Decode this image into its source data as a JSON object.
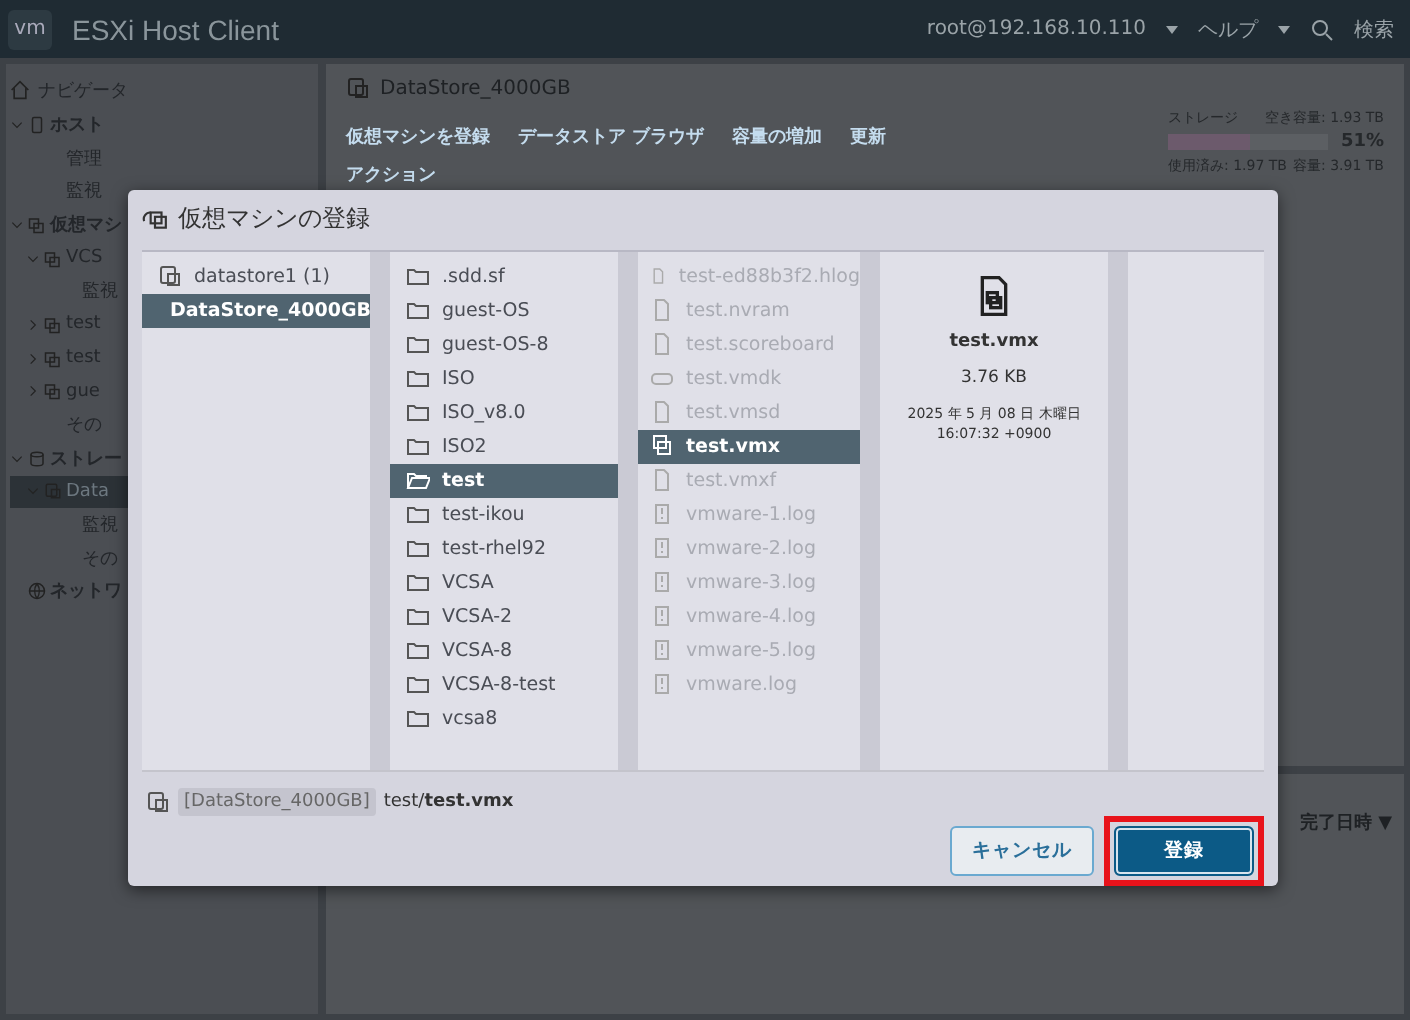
{
  "header": {
    "logo": "vm",
    "title": "ESXi Host Client",
    "user": "root@192.168.10.110",
    "help": "ヘルプ",
    "search": "検索"
  },
  "navigator": {
    "title": "ナビゲータ",
    "items": [
      {
        "label": "ホスト",
        "kind": "host",
        "expanded": true,
        "children": [
          {
            "label": "管理",
            "kind": "leaf"
          },
          {
            "label": "監視",
            "kind": "leaf"
          }
        ]
      },
      {
        "label": "仮想マシ",
        "kind": "vms",
        "expanded": true,
        "children": [
          {
            "label": "VCS",
            "kind": "vm",
            "expanded": true,
            "children": [
              {
                "label": "監視",
                "kind": "leaf"
              }
            ]
          },
          {
            "label": "test",
            "kind": "vm",
            "expanded": false
          },
          {
            "label": "test",
            "kind": "vm",
            "expanded": false
          },
          {
            "label": "gue",
            "kind": "vm",
            "expanded": false
          },
          {
            "label": "その",
            "kind": "leaf"
          }
        ]
      },
      {
        "label": "ストレー",
        "kind": "storage",
        "expanded": true,
        "children": [
          {
            "label": "Data",
            "kind": "ds",
            "expanded": true,
            "selected": true,
            "children": [
              {
                "label": "監視",
                "kind": "leaf"
              },
              {
                "label": "その",
                "kind": "leaf"
              }
            ]
          }
        ]
      },
      {
        "label": "ネットワ",
        "kind": "network"
      }
    ]
  },
  "main": {
    "title": "DataStore_4000GB",
    "toolbar": [
      "仮想マシンを登録",
      "データストア ブラウザ",
      "容量の増加",
      "更新"
    ],
    "actions": "アクション",
    "storage": {
      "label": "ストレージ",
      "free": "空き容量: 1.93 TB",
      "level": 0.51,
      "percent": "51%",
      "used": "使用済み: 1.97 TB",
      "capacity": "容量: 3.91 TB"
    },
    "tasks_column": "完了日時 ▼"
  },
  "dialog": {
    "title": "仮想マシンの登録",
    "datastores": [
      {
        "name": "datastore1 (1)",
        "selected": false
      },
      {
        "name": "DataStore_4000GB",
        "selected": true
      }
    ],
    "folders": [
      {
        "name": ".sdd.sf",
        "selected": false
      },
      {
        "name": "guest-OS",
        "selected": false
      },
      {
        "name": "guest-OS-8",
        "selected": false
      },
      {
        "name": "ISO",
        "selected": false
      },
      {
        "name": "ISO_v8.0",
        "selected": false
      },
      {
        "name": "ISO2",
        "selected": false
      },
      {
        "name": "test",
        "selected": true
      },
      {
        "name": "test-ikou",
        "selected": false
      },
      {
        "name": "test-rhel92",
        "selected": false
      },
      {
        "name": "VCSA",
        "selected": false
      },
      {
        "name": "VCSA-2",
        "selected": false
      },
      {
        "name": "VCSA-8",
        "selected": false
      },
      {
        "name": "VCSA-8-test",
        "selected": false
      },
      {
        "name": "vcsa8",
        "selected": false
      }
    ],
    "files": [
      {
        "name": "test-ed88b3f2.hlog",
        "kind": "file",
        "disabled": true,
        "selected": false
      },
      {
        "name": "test.nvram",
        "kind": "file",
        "disabled": true,
        "selected": false
      },
      {
        "name": "test.scoreboard",
        "kind": "file",
        "disabled": true,
        "selected": false
      },
      {
        "name": "test.vmdk",
        "kind": "disk",
        "disabled": true,
        "selected": false
      },
      {
        "name": "test.vmsd",
        "kind": "file",
        "disabled": true,
        "selected": false
      },
      {
        "name": "test.vmx",
        "kind": "vm",
        "disabled": false,
        "selected": true
      },
      {
        "name": "test.vmxf",
        "kind": "file",
        "disabled": true,
        "selected": false
      },
      {
        "name": "vmware-1.log",
        "kind": "log",
        "disabled": true,
        "selected": false
      },
      {
        "name": "vmware-2.log",
        "kind": "log",
        "disabled": true,
        "selected": false
      },
      {
        "name": "vmware-3.log",
        "kind": "log",
        "disabled": true,
        "selected": false
      },
      {
        "name": "vmware-4.log",
        "kind": "log",
        "disabled": true,
        "selected": false
      },
      {
        "name": "vmware-5.log",
        "kind": "log",
        "disabled": true,
        "selected": false
      },
      {
        "name": "vmware.log",
        "kind": "log",
        "disabled": true,
        "selected": false
      }
    ],
    "details": {
      "name": "test.vmx",
      "size": "3.76 KB",
      "date": "2025 年 5 月 08 日 木曜日",
      "time": "16:07:32 +0900"
    },
    "path": {
      "datastore": "[DataStore_4000GB]",
      "file": "test/**test.vmx**"
    },
    "buttons": [
      {
        "label": "キャンセル",
        "kind": "secondary",
        "highlighted": false
      },
      {
        "label": "登録",
        "kind": "primary",
        "highlighted": true
      }
    ]
  }
}
